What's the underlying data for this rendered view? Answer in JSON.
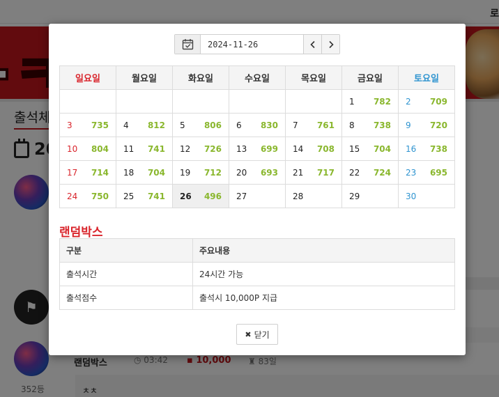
{
  "background": {
    "topbar_text": "로",
    "banner_text": "·ㅋ",
    "attend_title": "출석체",
    "year_partial": "20",
    "row": {
      "name": "랜덤박스",
      "time": "03:42",
      "points": "10,000",
      "days": "83일"
    },
    "rank": "352등",
    "comment": "ㅊㅊ"
  },
  "datepicker": {
    "value": "2024-11-26",
    "prev_icon": "chevron-left-icon",
    "next_icon": "chevron-right-icon",
    "calendar_icon": "calendar-check-icon"
  },
  "calendar": {
    "weekdays": [
      "일요일",
      "월요일",
      "화요일",
      "수요일",
      "목요일",
      "금요일",
      "토요일"
    ],
    "weeks": [
      [
        null,
        null,
        null,
        null,
        null,
        {
          "day": "1",
          "points": "782"
        },
        {
          "day": "2",
          "points": "709"
        }
      ],
      [
        {
          "day": "3",
          "points": "735"
        },
        {
          "day": "4",
          "points": "812"
        },
        {
          "day": "5",
          "points": "806"
        },
        {
          "day": "6",
          "points": "830"
        },
        {
          "day": "7",
          "points": "761"
        },
        {
          "day": "8",
          "points": "738"
        },
        {
          "day": "9",
          "points": "720"
        }
      ],
      [
        {
          "day": "10",
          "points": "804"
        },
        {
          "day": "11",
          "points": "741"
        },
        {
          "day": "12",
          "points": "726"
        },
        {
          "day": "13",
          "points": "699"
        },
        {
          "day": "14",
          "points": "708"
        },
        {
          "day": "15",
          "points": "704"
        },
        {
          "day": "16",
          "points": "738"
        }
      ],
      [
        {
          "day": "17",
          "points": "714"
        },
        {
          "day": "18",
          "points": "704"
        },
        {
          "day": "19",
          "points": "712"
        },
        {
          "day": "20",
          "points": "693"
        },
        {
          "day": "21",
          "points": "717"
        },
        {
          "day": "22",
          "points": "724"
        },
        {
          "day": "23",
          "points": "695"
        }
      ],
      [
        {
          "day": "24",
          "points": "750"
        },
        {
          "day": "25",
          "points": "741"
        },
        {
          "day": "26",
          "points": "496",
          "today": true
        },
        {
          "day": "27",
          "points": ""
        },
        {
          "day": "28",
          "points": ""
        },
        {
          "day": "29",
          "points": ""
        },
        {
          "day": "30",
          "points": ""
        }
      ]
    ]
  },
  "random_box": {
    "title": "랜덤박스",
    "headers": [
      "구분",
      "주요내용"
    ],
    "rows": [
      [
        "출석시간",
        "24시간 가능"
      ],
      [
        "출석점수",
        "출석시 10,000P 지급"
      ]
    ]
  },
  "close_button": {
    "label": "닫기",
    "icon": "close-icon"
  },
  "colors": {
    "sunday": "#d9242b",
    "saturday": "#2f94d0",
    "points": "#8ab72e",
    "accent": "#c4161c"
  }
}
